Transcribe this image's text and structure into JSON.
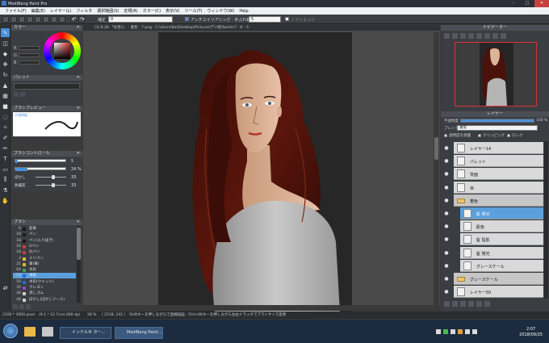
{
  "window": {
    "title": "MediBang Paint Pro"
  },
  "menu": [
    "ファイル(F)",
    "編集(E)",
    "レイヤー(L)",
    "フィルタ",
    "選択範囲(S)",
    "定規(R)",
    "カラー(C)",
    "表示(V)",
    "ツール(T)",
    "ウィンドウ(W)",
    "Help"
  ],
  "toolbar": {
    "correction_label": "補正",
    "correction_value": "0",
    "antialias_label": "アンチエイリアシング",
    "hand_correction_label": "手ぶれ補正",
    "hand_correction_value": "5",
    "soft_edge_label": "ソフトエッジ"
  },
  "document": {
    "path": "[1] 8.28 「女性1」 - 着色 - 7.png - C:\\Users\\Kai\\Desktop\\Pictures\\デジ絵\\fwchie7 - 8 - ①"
  },
  "panels": {
    "color": {
      "title": "カラー",
      "r": "R",
      "g": "G",
      "b": "B",
      "r_val": "",
      "g_val": "",
      "b_val": ""
    },
    "palette": {
      "title": "パレット"
    },
    "brush_preview": {
      "title": "ブラシプレビュー",
      "label": "不透明度"
    },
    "brush_control": {
      "title": "ブラシコントロール",
      "size_value": "5",
      "opacity_value": "24 %",
      "blur_label": "ぼかし",
      "blur_value": "33",
      "mix_label": "色補充",
      "mix_value": "33"
    },
    "brush_list": {
      "title": "ブラシ",
      "items": [
        {
          "size": "6",
          "name": "鉛筆",
          "color": "#1a1a1a"
        },
        {
          "size": "18",
          "name": "ペン",
          "color": "#1a1a1a"
        },
        {
          "size": "18",
          "name": "ペン(入り抜き)",
          "color": "#1a1a1a"
        },
        {
          "size": "16",
          "name": "Gペン",
          "color": "#d23a3a"
        },
        {
          "size": "18",
          "name": "丸ペン",
          "color": "#d23a3a"
        },
        {
          "size": "3",
          "name": "ミリペン",
          "color": "#e0b82a"
        },
        {
          "size": "21",
          "name": "筆(筆)",
          "color": "#e0b82a"
        },
        {
          "size": "64",
          "name": "水彩",
          "color": "#38a64a"
        },
        {
          "size": "53",
          "name": "水彩",
          "color": "#1e6fd1"
        },
        {
          "size": "50",
          "name": "水彩(ウェット)",
          "color": "#1e6fd1"
        },
        {
          "size": "35",
          "name": "クレヨン",
          "color": "#8d4bc4"
        },
        {
          "size": "44",
          "name": "消しゴム",
          "color": "#cccccc"
        },
        {
          "size": "44",
          "name": "ぼかし(ぼかしツール)",
          "color": "#cccccc"
        }
      ],
      "selected_index": 8
    },
    "navigator": {
      "title": "ナビゲーター"
    },
    "layers": {
      "title": "レイヤー",
      "opacity_label": "不透明度",
      "opacity_value": "100 %",
      "blend_label": "ブレンド",
      "blend_value": "通常",
      "protect_alpha": "透明度を保護",
      "clipping": "クリッピング",
      "lock": "ロック",
      "items": [
        {
          "name": "レイヤー14",
          "folder": false,
          "selected": false,
          "indent": 0
        },
        {
          "name": "パレット",
          "folder": false,
          "selected": false,
          "indent": 0
        },
        {
          "name": "背面",
          "folder": false,
          "selected": false,
          "indent": 0
        },
        {
          "name": "目",
          "folder": false,
          "selected": false,
          "indent": 0
        },
        {
          "name": "着色",
          "folder": true,
          "selected": false,
          "indent": 0
        },
        {
          "name": "肌 発光",
          "folder": false,
          "selected": true,
          "indent": 1
        },
        {
          "name": "肌色",
          "folder": false,
          "selected": false,
          "indent": 1
        },
        {
          "name": "髪 陰影",
          "folder": false,
          "selected": false,
          "indent": 1
        },
        {
          "name": "髪 発光",
          "folder": false,
          "selected": false,
          "indent": 1
        },
        {
          "name": "グレースケール",
          "folder": false,
          "selected": false,
          "indent": 1
        },
        {
          "name": "グレースケール",
          "folder": true,
          "selected": false,
          "indent": 0
        },
        {
          "name": "レイヤー50",
          "folder": false,
          "selected": false,
          "indent": 0
        }
      ]
    }
  },
  "status": {
    "size": "2100 * 3000 pixel",
    "print": "(9.1 * 12.7cm)",
    "dpi": "600 dpi",
    "zoom": "28 %",
    "coords": "( 2518, 242 )",
    "hint": "Shiftキーを押しながらで直線描画、Ctrl+Altキーを押しながら左右ドラッグでブラシサイズ変更"
  },
  "taskbar": {
    "tasks": [
      "インテル® ター...",
      "MediBang Paint..."
    ],
    "time": "2:07",
    "date": "2018/09/25"
  }
}
